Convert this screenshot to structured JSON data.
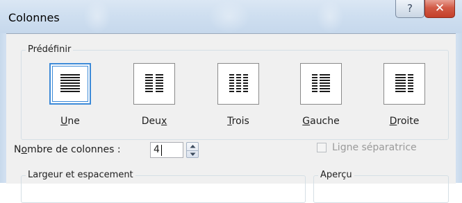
{
  "window": {
    "title": "Colonnes",
    "help_label": "?",
    "close_label": "✕"
  },
  "presets": {
    "group_label": "Prédéfinir",
    "selected": "Une",
    "items": [
      {
        "id": "une",
        "prefix": "",
        "accel": "U",
        "suffix": "ne",
        "icon": "one-column-icon"
      },
      {
        "id": "deux",
        "prefix": "Deu",
        "accel": "x",
        "suffix": "",
        "icon": "two-columns-icon"
      },
      {
        "id": "trois",
        "prefix": "",
        "accel": "T",
        "suffix": "rois",
        "icon": "three-columns-icon"
      },
      {
        "id": "gauche",
        "prefix": "",
        "accel": "G",
        "suffix": "auche",
        "icon": "left-column-icon"
      },
      {
        "id": "droite",
        "prefix": "",
        "accel": "D",
        "suffix": "roite",
        "icon": "right-column-icon"
      }
    ]
  },
  "columns_count": {
    "label_prefix": "N",
    "label_accel": "o",
    "label_suffix": "mbre de colonnes :",
    "value": "4"
  },
  "separator": {
    "label": "Ligne séparatrice",
    "checked": false,
    "enabled": false
  },
  "width_spacing": {
    "group_label": "Largeur et espacement"
  },
  "preview": {
    "group_label": "Aperçu"
  },
  "colors": {
    "selection": "#3c8ad8",
    "dialog_bg": "#f0f0f0",
    "close_red": "#c3402a"
  }
}
